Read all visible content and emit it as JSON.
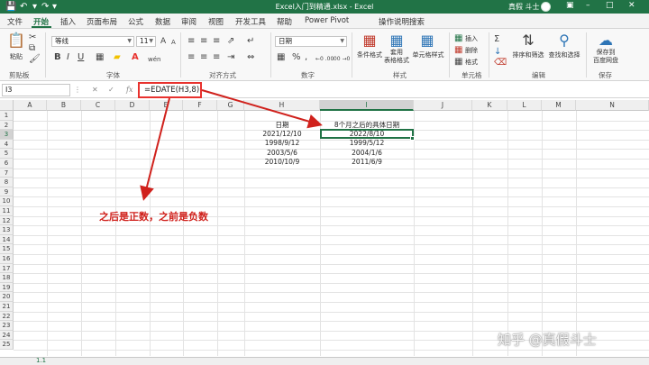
{
  "titlebar": {
    "title": "Excel入门到精通.xlsx - Excel",
    "user": "真假 斗士",
    "save_icon": "save-icon",
    "undo_icon": "undo-icon",
    "redo_icon": "redo-icon",
    "restore_icon": "ribbon-display-icon",
    "minimize_icon": "minimize-icon",
    "maximize_icon": "maximize-icon",
    "close_icon": "close-icon",
    "accent": "#217346"
  },
  "menu": {
    "tabs": [
      "文件",
      "开始",
      "插入",
      "页面布局",
      "公式",
      "数据",
      "审阅",
      "视图",
      "开发工具",
      "帮助",
      "Power Pivot"
    ],
    "active": "开始",
    "tell_me": "操作说明搜索",
    "share": "共享"
  },
  "ribbon": {
    "clipboard": {
      "group": "剪贴板",
      "paste": "粘贴"
    },
    "font": {
      "group": "字体",
      "font_name": "等线",
      "font_size": "11",
      "grow": "A",
      "shrink": "A",
      "bold": "B",
      "italic": "I",
      "underline": "U",
      "wen": "wén"
    },
    "alignment": {
      "group": "对齐方式"
    },
    "number": {
      "group": "数字",
      "format": "日期",
      "percent": "%",
      "comma": ",",
      "inc_dec": "←0 .00",
      "dec_dec": ".00 →0"
    },
    "styles": {
      "group": "样式",
      "conditional": "条件格式",
      "table": "套用\n表格格式",
      "cell_styles": "单元格样式"
    },
    "cells": {
      "group": "单元格",
      "insert": "插入",
      "delete": "删除",
      "format": "格式"
    },
    "editing": {
      "group": "编辑",
      "sort": "排序和筛选",
      "find": "查找和选择"
    },
    "save": {
      "group": "保存",
      "label": "保存到\n百度网盘"
    }
  },
  "formula_bar": {
    "name_box": "I3",
    "formula": "=EDATE(H3,8)",
    "cancel": "✕",
    "enter": "✓",
    "fx": "fx"
  },
  "grid": {
    "columns": [
      "A",
      "B",
      "C",
      "D",
      "E",
      "F",
      "G",
      "H",
      "I",
      "J",
      "K",
      "L",
      "M",
      "N"
    ],
    "rows": [
      "1",
      "2",
      "3",
      "4",
      "5",
      "6",
      "7",
      "8",
      "9",
      "10",
      "11",
      "12",
      "13",
      "14",
      "15",
      "16",
      "17",
      "18",
      "19",
      "20",
      "21",
      "22",
      "23",
      "24",
      "25"
    ],
    "selected_column": "I",
    "selected_row": "3",
    "headers": {
      "H": "日期",
      "I": "8个月之后的具体日期"
    },
    "data": [
      {
        "H": "2021/12/10",
        "I": "2022/8/10"
      },
      {
        "H": "1998/9/12",
        "I": "1999/5/12"
      },
      {
        "H": "2003/5/6",
        "I": "2004/1/6"
      },
      {
        "H": "2010/10/9",
        "I": "2011/6/9"
      }
    ]
  },
  "annotation": {
    "text": "之后是正数，之前是负数",
    "color": "#d0211c"
  },
  "watermark": "知乎 @真假斗士",
  "sheet_tab": "1.1"
}
